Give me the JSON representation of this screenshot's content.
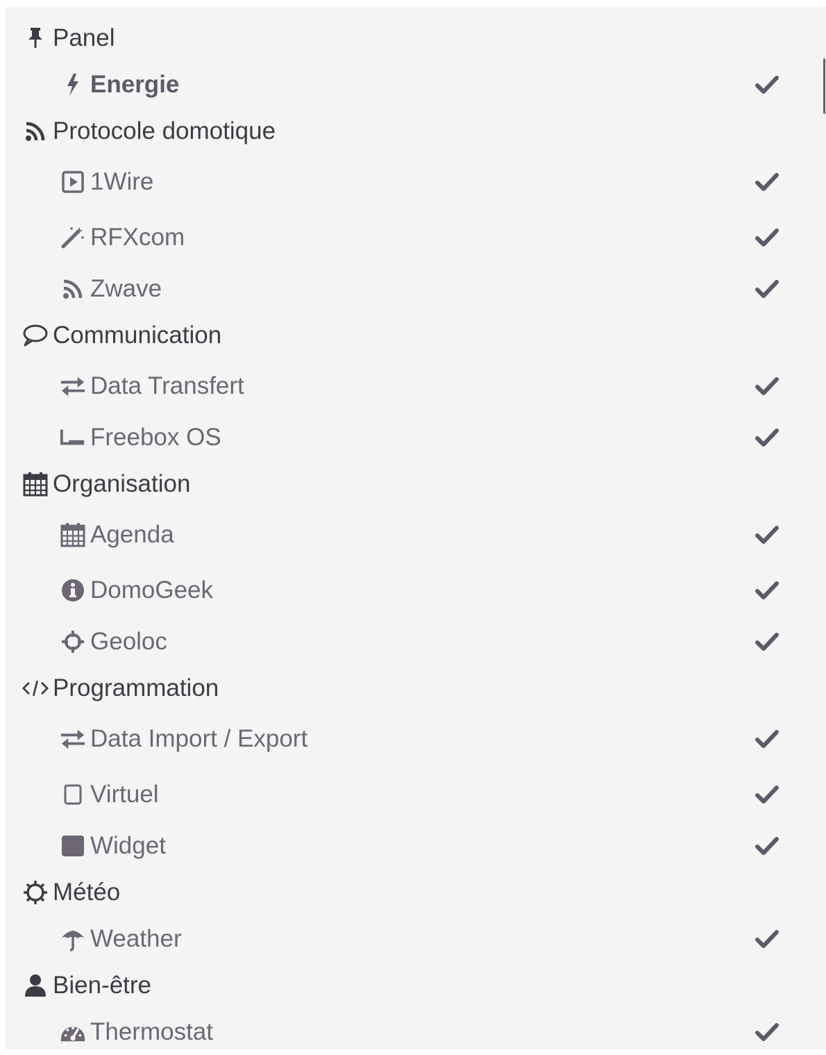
{
  "menu": [
    {
      "label": "Panel",
      "icon": "pin-icon",
      "items": [
        {
          "label": "Energie",
          "icon": "bolt-icon",
          "checked": true,
          "active": true
        }
      ]
    },
    {
      "label": "Protocole domotique",
      "icon": "rss-icon",
      "items": [
        {
          "label": "1Wire",
          "icon": "play-square-icon",
          "checked": true
        },
        {
          "label": "RFXcom",
          "icon": "magic-wand-icon",
          "checked": true
        },
        {
          "label": "Zwave",
          "icon": "rss-icon",
          "checked": true
        }
      ]
    },
    {
      "label": "Communication",
      "icon": "speech-bubble-icon",
      "items": [
        {
          "label": "Data Transfert",
          "icon": "exchange-icon",
          "checked": true
        },
        {
          "label": "Freebox OS",
          "icon": "router-icon",
          "checked": true
        }
      ]
    },
    {
      "label": "Organisation",
      "icon": "calendar-icon",
      "items": [
        {
          "label": "Agenda",
          "icon": "calendar-icon",
          "checked": true
        },
        {
          "label": "DomoGeek",
          "icon": "info-circle-icon",
          "checked": true
        },
        {
          "label": "Geoloc",
          "icon": "crosshairs-icon",
          "checked": true
        }
      ]
    },
    {
      "label": "Programmation",
      "icon": "code-icon",
      "items": [
        {
          "label": "Data Import / Export",
          "icon": "exchange-icon",
          "checked": true
        },
        {
          "label": "Virtuel",
          "icon": "square-outline-icon",
          "checked": true
        },
        {
          "label": "Widget",
          "icon": "square-filled-icon",
          "checked": true
        }
      ]
    },
    {
      "label": "Météo",
      "icon": "sun-icon",
      "items": [
        {
          "label": "Weather",
          "icon": "umbrella-icon",
          "checked": true
        }
      ]
    },
    {
      "label": "Bien-être",
      "icon": "user-icon",
      "items": [
        {
          "label": "Thermostat",
          "icon": "dashboard-icon",
          "checked": true
        }
      ]
    }
  ],
  "colors": {
    "panel_bg": "#f4f4f4",
    "category_text": "#3d3c44",
    "item_text": "#6c6773",
    "check": "#5e5968"
  }
}
